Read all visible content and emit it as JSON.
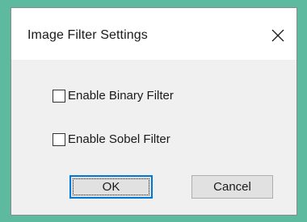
{
  "dialog": {
    "title": "Image Filter Settings",
    "close_icon": "close-icon",
    "options": [
      {
        "label": "Enable Binary Filter",
        "checked": false
      },
      {
        "label": "Enable Sobel Filter",
        "checked": false
      }
    ],
    "buttons": {
      "ok_label": "OK",
      "cancel_label": "Cancel"
    }
  },
  "colors": {
    "background": "#5dba9e",
    "dialog_body": "#f0f0f0",
    "titlebar": "#ffffff",
    "default_button_border": "#0078d7"
  }
}
